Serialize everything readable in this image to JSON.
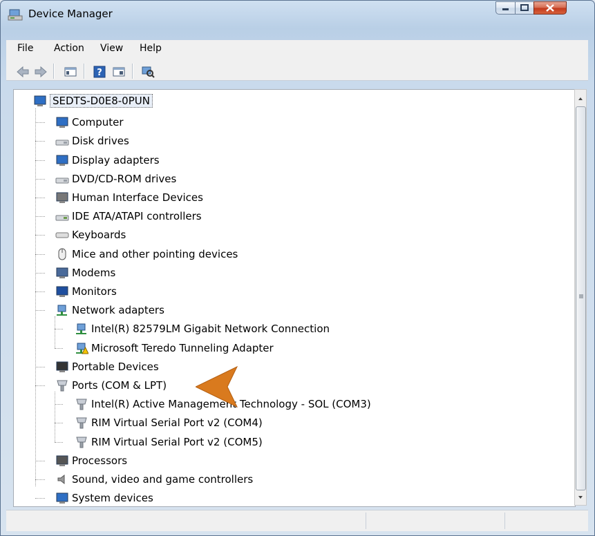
{
  "window": {
    "title": "Device Manager"
  },
  "menu": {
    "items": [
      "File",
      "Action",
      "View",
      "Help"
    ]
  },
  "tree": {
    "root": "SEDTS-D0E8-0PUN",
    "categories": [
      {
        "label": "Computer",
        "icon": "computer-icon"
      },
      {
        "label": "Disk drives",
        "icon": "disk-drive-icon"
      },
      {
        "label": "Display adapters",
        "icon": "display-adapter-icon"
      },
      {
        "label": "DVD/CD-ROM drives",
        "icon": "dvd-drive-icon"
      },
      {
        "label": "Human Interface Devices",
        "icon": "hid-icon"
      },
      {
        "label": "IDE ATA/ATAPI controllers",
        "icon": "ide-controller-icon"
      },
      {
        "label": "Keyboards",
        "icon": "keyboard-icon"
      },
      {
        "label": "Mice and other pointing devices",
        "icon": "mouse-icon"
      },
      {
        "label": "Modems",
        "icon": "modem-icon"
      },
      {
        "label": "Monitors",
        "icon": "monitor-icon"
      },
      {
        "label": "Network adapters",
        "icon": "network-adapter-icon"
      },
      {
        "label": "Intel(R) 82579LM Gigabit Network Connection",
        "icon": "network-adapter-icon"
      },
      {
        "label": "Microsoft Teredo Tunneling Adapter",
        "icon": "network-adapter-warning-icon"
      },
      {
        "label": "Portable Devices",
        "icon": "portable-device-icon"
      },
      {
        "label": "Ports (COM & LPT)",
        "icon": "port-icon"
      },
      {
        "label": "Intel(R) Active Management Technology - SOL (COM3)",
        "icon": "port-icon"
      },
      {
        "label": "RIM Virtual Serial Port v2 (COM4)",
        "icon": "port-icon"
      },
      {
        "label": "RIM Virtual Serial Port v2 (COM5)",
        "icon": "port-icon"
      },
      {
        "label": "Processors",
        "icon": "processor-icon"
      },
      {
        "label": "Sound, video and game controllers",
        "icon": "sound-icon"
      },
      {
        "label": "System devices",
        "icon": "system-device-icon"
      }
    ]
  },
  "colors": {
    "callout_arrow": "#d97a1e",
    "selection_border": "#666666"
  }
}
